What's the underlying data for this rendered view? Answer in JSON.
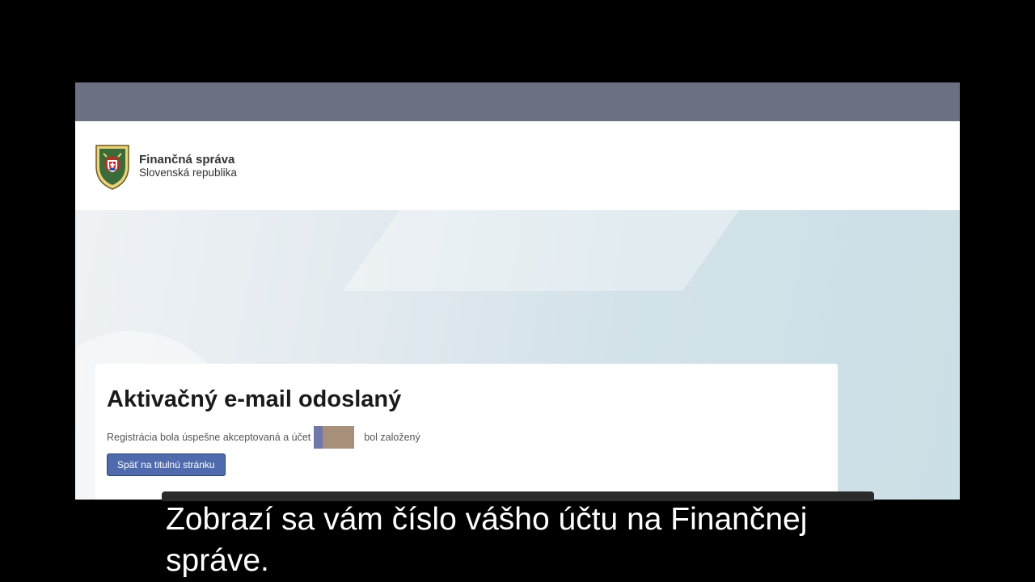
{
  "org": {
    "name": "Finančná správa",
    "country": "Slovenská republika",
    "logo_icon": "coat-of-arms-icon"
  },
  "card": {
    "title": "Aktivačný e-mail odoslaný",
    "message_before": "Registrácia bola úspešne akceptovaná a účet",
    "message_after": "bol založený",
    "back_button": "Späť na titulnú stránku"
  },
  "caption": {
    "text": "Zobrazí sa vám číslo vášho účtu na Finančnej správe."
  },
  "colors": {
    "top_bar": "#6b7083",
    "button": "#4f6bad"
  }
}
